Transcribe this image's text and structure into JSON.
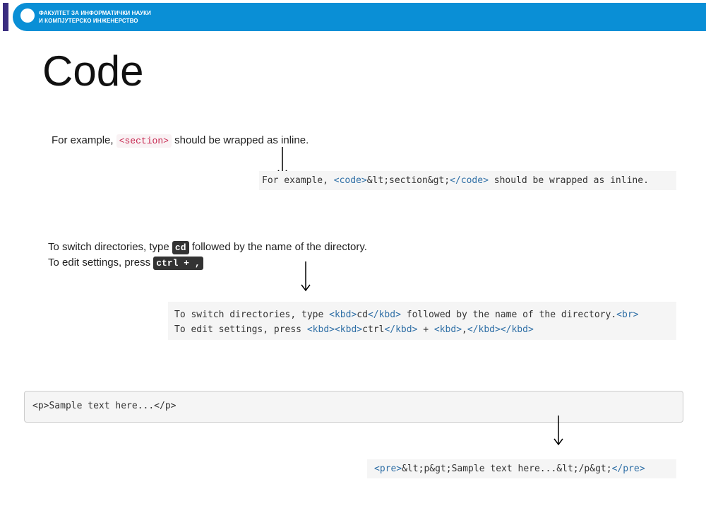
{
  "header": {
    "faculty_line1": "ФАКУЛТЕТ ЗА ИНФОРМАТИЧКИ НАУКИ",
    "faculty_line2": "И КОМПЈУТЕРСКО ИНЖЕНЕРСТВО"
  },
  "title": "Code",
  "example1": {
    "text_before": "For example,",
    "code": "<section>",
    "text_after": "should be wrapped as inline.",
    "source": {
      "p1": "For example, ",
      "t1": "<code>",
      "p2": "&lt;section&gt;",
      "t2": "</code>",
      "p3": " should be wrapped as inline."
    }
  },
  "example2": {
    "line1_before": "To switch directories, type",
    "kbd1": "cd",
    "line1_after": "followed by the name of the directory.",
    "line2_before": "To edit settings, press",
    "kbd2": "ctrl + ,",
    "source": {
      "l1a": "To switch directories, type ",
      "l1b": "<kbd>",
      "l1c": "cd",
      "l1d": "</kbd>",
      "l1e": " followed by the name of the directory.",
      "l1f": "<br>",
      "l2a": "To edit settings, press ",
      "l2b": "<kbd><kbd>",
      "l2c": "ctrl",
      "l2d": "</kbd>",
      "l2e": " + ",
      "l2f": "<kbd>",
      "l2g": ",",
      "l2h": "</kbd></kbd>"
    }
  },
  "example3": {
    "pre_rendered": "<p>Sample text here...</p>",
    "source": {
      "t1": "<pre>",
      "p1": "&lt;p&gt;Sample text here...&lt;/p&gt;",
      "t2": "</pre>"
    }
  }
}
